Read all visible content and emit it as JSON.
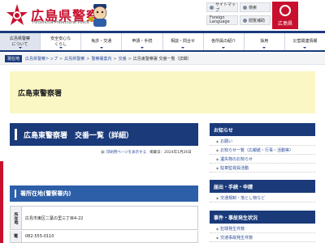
{
  "header": {
    "title": "広島県警察",
    "subtitle": "Hiroshima Prefectural Police",
    "util": {
      "sitemap": "サイトマップ",
      "search": "検索",
      "lang_top": "Foreign",
      "lang_bottom": "Language",
      "size": "閲覧補助"
    },
    "prefecture": "広島県"
  },
  "nav": [
    "広島県警察\nについて",
    "安全安心な\nくらし",
    "免許・交通",
    "申請・手続",
    "相談・問合せ",
    "各所属の紹介",
    "採用",
    "災害関連情報"
  ],
  "breadcrumb": {
    "here": "現在地",
    "items": [
      "広島県警察トップ",
      "広島県警察",
      "警察署案内",
      "交番",
      "広島東警察署 交番一覧（詳細）"
    ]
  },
  "band": {
    "title": "広島東警察署"
  },
  "main": {
    "heading": "広島東警察署　交番一覧（詳細）",
    "print_label": "印刷用ページを表示する",
    "published": "掲載日：2024年1月26日",
    "section_heading": "署所在地(警察署内)",
    "rows": [
      {
        "th": "所在地",
        "td": "広島市東区二葉の里三丁目4-22"
      },
      {
        "th": "電",
        "td": "082-555-0110"
      }
    ]
  },
  "sidebar": {
    "notice_heading": "お知らせ",
    "notice_links": [
      "お願い",
      "お知らせ一覧（広報紙・行事・活動等）",
      "遺失物のお知らせ",
      "駐車監視員活動"
    ],
    "forms_heading": "届出・手続・申請",
    "forms_links": [
      "交通規制・落とし物など"
    ],
    "cases_heading": "事件・事故発生状況",
    "cases_links": [
      "犯罪発生件数",
      "交通事故発生件数"
    ]
  }
}
